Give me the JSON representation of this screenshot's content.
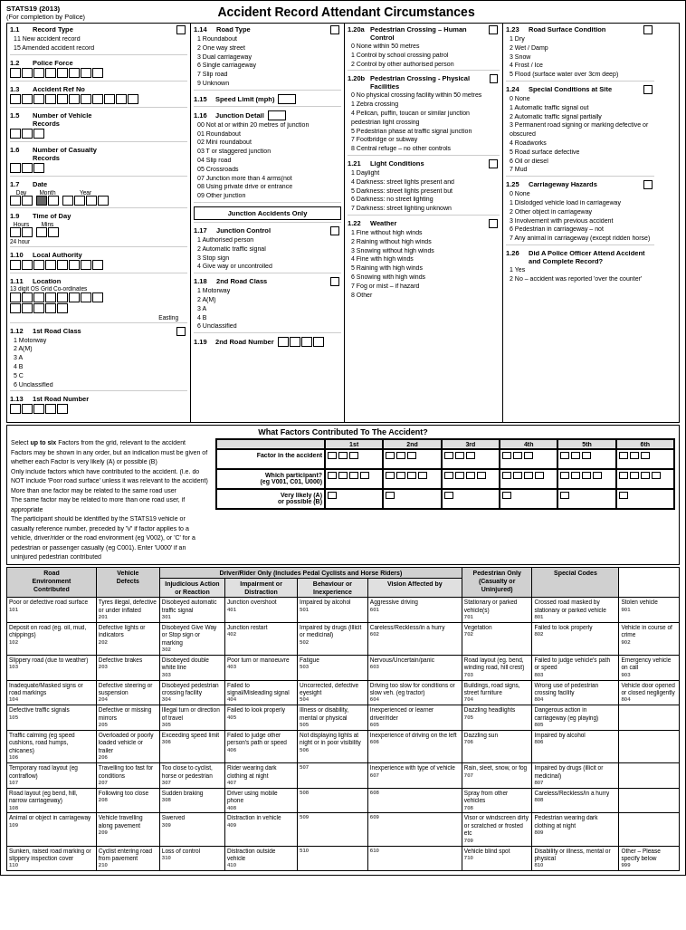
{
  "header": {
    "stats_title": "STATS19 (2013)",
    "completion": "(For completion by Police)",
    "main_title": "Accident Record  Attendant Circumstances"
  },
  "col1": {
    "fields": [
      {
        "id": "1.1",
        "label": "Record Type",
        "options": [
          "11  New accident record",
          "15  Amended accident record"
        ],
        "has_checkbox": true
      },
      {
        "id": "1.2",
        "label": "Police Force"
      },
      {
        "id": "1.3",
        "label": "Accident Ref No"
      },
      {
        "id": "1.5",
        "label": "Number of Vehicle Records"
      },
      {
        "id": "1.6",
        "label": "Number of Casualty Records"
      },
      {
        "id": "1.7",
        "label": "Date",
        "has_date": true,
        "date_labels": [
          "Day",
          "Month",
          "Year"
        ]
      },
      {
        "id": "1.9",
        "label": "Time of Day",
        "sub": "24 hour",
        "has_time": true,
        "time_labels": [
          "Hours",
          "Mins"
        ]
      },
      {
        "id": "1.10",
        "label": "Local Authority"
      },
      {
        "id": "1.11",
        "label": "Location",
        "sub": "13 digit OS Grid Co-ordinates",
        "has_easting": true
      },
      {
        "id": "1.12",
        "label": "1st Road Class",
        "options": [
          "1  Motorway",
          "2  A(M)",
          "3  A",
          "4  B",
          "5  C",
          "6  Unclassified"
        ],
        "has_checkbox": true
      },
      {
        "id": "1.13",
        "label": "1st Road Number"
      }
    ]
  },
  "col2": {
    "fields": [
      {
        "id": "1.14",
        "label": "Road Type",
        "options": [
          "1  Roundabout",
          "2  One way street",
          "3  Dual carriageway",
          "6  Single carriageway",
          "7  Slip road",
          "9  Unknown"
        ],
        "has_checkbox": true
      },
      {
        "id": "1.15",
        "label": "Speed Limit (mph)",
        "has_input": true
      },
      {
        "id": "1.16",
        "label": "Junction Detail",
        "options": [
          "00  Not at or within 20 metres of junction",
          "01  Roundabout",
          "02  Mini roundabout",
          "03  T or staggered junction",
          "04  Slip road",
          "05  Crossroads",
          "07  Junction more than 4 arms(not",
          "08  Using private drive or entrance",
          "09  Other junction"
        ],
        "has_input": true
      },
      {
        "id": "",
        "label": "Junction Accidents Only"
      },
      {
        "id": "1.17",
        "label": "Junction Control",
        "options": [
          "1  Authorised person",
          "2  Automatic traffic signal",
          "3  Stop sign",
          "4  Give way or uncontrolled"
        ],
        "has_checkbox": true
      },
      {
        "id": "1.18",
        "label": "2nd Road Class",
        "options": [
          "1  Motorway",
          "2  A(M)",
          "3  A",
          "4  B",
          "6  Unclassified"
        ],
        "has_checkbox": true
      },
      {
        "id": "1.19",
        "label": "2nd Road Number"
      }
    ]
  },
  "col3": {
    "fields": [
      {
        "id": "1.20a",
        "label": "Pedestrian Crossing – Human Control",
        "options": [
          "0  None within 50 metres",
          "1  Control by school crossing patrol",
          "2  Control by other authorised person"
        ],
        "has_checkbox": true
      },
      {
        "id": "1.20b",
        "label": "Pedestrian Crossing - Physical Facilities",
        "options": [
          "0  No physical crossing facility within 50 metres",
          "1  Zebra crossing",
          "4  Pelican, puffin, toucan or similar junction pedestrian light crossing",
          "5  Pedestrian phase at traffic signal junction",
          "7  Footbridge or subway",
          "8  Central refuge – no other controls"
        ],
        "has_checkbox": true
      },
      {
        "id": "1.21",
        "label": "Light Conditions",
        "options": [
          "1  Daylight",
          "4  Darkness: street lights present and",
          "5  Darkness: street lights present but",
          "6  Darkness: no street lighting",
          "7  Darkness: street lighting unknown"
        ],
        "has_checkbox": true
      },
      {
        "id": "1.22",
        "label": "Weather",
        "options": [
          "1  Fine without high winds",
          "2  Raining without high winds",
          "3  Snowing without high winds",
          "4  Fine with high winds",
          "5  Raining with high winds",
          "6  Snowing with high winds",
          "7  Fog or mist – if hazard",
          "8  Other"
        ],
        "has_checkbox": true
      }
    ]
  },
  "col4": {
    "fields": [
      {
        "id": "1.23",
        "label": "Road Surface Condition",
        "options": [
          "1  Dry",
          "2  Wet / Damp",
          "3  Snow",
          "4  Frost / Ice",
          "5  Flood (surface water over 3cm deep)"
        ],
        "has_checkbox": true
      },
      {
        "id": "1.24",
        "label": "Special Conditions at Site",
        "options": [
          "0  None",
          "1  Automatic traffic signal out",
          "2  Automatic traffic signal partially",
          "3  Permanent road signing or marking defective or obscured",
          "4  Roadworks",
          "5  Road surface defective",
          "6  Oil or diesel",
          "7  Mud"
        ],
        "has_checkbox": true
      },
      {
        "id": "1.25",
        "label": "Carriageway Hazards",
        "options": [
          "0  None",
          "1  Dislodged vehicle load in carriageway",
          "2  Other object in carriageway",
          "3  Involvement with previous accident",
          "6  Pedestrian in carriageway – not",
          "7  Any animal in carriageway (except ridden horse)"
        ],
        "has_checkbox": true
      },
      {
        "id": "1.26",
        "label": "Did A Police Officer Attend Accident and Complete Record?",
        "options": [
          "1  Yes",
          "2  No – accident was reported 'over the counter'"
        ],
        "has_checkbox": true
      }
    ]
  },
  "factors_section": {
    "title": "What Factors Contributed To The Accident?",
    "instructions": [
      "Select up to six Factors from the grid, relevant to the accident",
      "Factors may be shown in any order, but an indication must be given of whether each Factor is very likely (A) or possible (B)",
      "Only include factors which have contributed to the accident. (I.e. do NOT include 'Poor road surface' unless it was relevant to the accident)",
      "More than one factor may be related to the same road user",
      "The same factor may be related to more than one road user, if appropriate",
      "The participant should be identified by the STATS19 vehicle or casualty reference number, preceded by 'V' if factor applies to a vehicle, driver/rider or the road environment (eg V002), or 'C' for a pedestrian or passenger casualty (eg C001). Enter 'U000' if an uninjured pedestrian contributed"
    ],
    "columns": [
      "1st",
      "2nd",
      "3rd",
      "4th",
      "5th",
      "6th"
    ],
    "rows": [
      {
        "label": "Factor in the accident",
        "sub": ""
      },
      {
        "label": "Which participant?",
        "sub": "(eg V001, C01, U000)"
      },
      {
        "label": "Very likely (A) or possible (B)",
        "sub": ""
      }
    ]
  },
  "bottom_table": {
    "col_headers": [
      "Road Environment Contributed",
      "Vehicle Defects",
      "Driver/Rider Only (Includes Pedal Cyclists and Horse Riders)",
      "Pedestrian Only (Casualty or Uninjured)",
      "Special Codes"
    ],
    "driver_sub_headers": [
      "Injudicious Action or Reaction",
      "Impairment or Distraction",
      "Behaviour or Inexperience",
      "Vision Affected by"
    ],
    "rows": [
      {
        "road": "Poor or defective road surface",
        "road_code": "101",
        "vehicle": "Tyres illegal, defective or under inflated",
        "vehicle_code": "201",
        "action": "Disobeyed automatic traffic signal",
        "action_code": "301",
        "action2": "Junction overshoot",
        "action2_code": "401",
        "impair": "Impaired by alcohol",
        "impair_code": "501",
        "behav": "Aggressive driving",
        "behav_code": "601",
        "vision": "Stationary or parked vehicle(s)",
        "vision_code": "701",
        "ped": "Crossed road masked by stationary or parked vehicle",
        "ped_code": "801",
        "special": "Stolen vehicle",
        "special_code": "901"
      },
      {
        "road": "Deposit on road (eg. oil, mud, chippings)",
        "road_code": "102",
        "vehicle": "Defective lights or indicators",
        "vehicle_code": "202",
        "action": "Disobeyed Give Way or Stop sign or marking",
        "action_code": "302",
        "action2": "Junction restart",
        "action2_code": "402",
        "impair": "Impaired by drugs (illicit or medicinal)",
        "impair_code": "502",
        "behav": "Careless/Reckless/in a hurry",
        "behav_code": "602",
        "vision": "Vegetation",
        "vision_code": "702",
        "ped": "Failed to look properly",
        "ped_code": "802",
        "special": "Vehicle in course of crime",
        "special_code": "902"
      },
      {
        "road": "Slippery road (due to weather)",
        "road_code": "103",
        "vehicle": "Defective brakes",
        "vehicle_code": "203",
        "action": "Disobeyed double white line",
        "action_code": "303",
        "action2": "Poor turn or manoeuvre",
        "action2_code": "403",
        "impair": "Fatigue",
        "impair_code": "503",
        "behav": "Nervous/Uncertain/panic",
        "behav_code": "603",
        "vision": "Road layout (eg. bend, winding road, hill crest)",
        "vision_code": "703",
        "ped": "Failed to judge vehicle's path or speed",
        "ped_code": "803",
        "special": "Emergency vehicle on call",
        "special_code": "903"
      },
      {
        "road": "Inadequate/Masked signs or road markings",
        "road_code": "104",
        "vehicle": "Defective steering or suspension",
        "vehicle_code": "204",
        "action": "Disobeyed pedestrian crossing facility",
        "action_code": "304",
        "action2": "Failed to signal/Misleading signal",
        "action2_code": "404",
        "impair": "Uncorrected, defective eyesight",
        "impair_code": "504",
        "behav": "Driving too slow for conditions or slow veh. (eg tractor)",
        "behav_code": "604",
        "vision": "Buildings, road signs, street furniture",
        "vision_code": "704",
        "ped": "Wrong use of pedestrian crossing facility",
        "ped_code": "804",
        "special": "Vehicle door opened or closed negligently",
        "special_code": "804"
      },
      {
        "road": "Defective traffic signals",
        "road_code": "105",
        "vehicle": "Defective or missing mirrors",
        "vehicle_code": "205",
        "action": "Illegal turn or direction of travel",
        "action_code": "305",
        "action2": "Failed to look properly",
        "action2_code": "405",
        "impair": "Illness or disability, mental or physical",
        "impair_code": "505",
        "behav": "Inexperienced or learner driver/rider",
        "behav_code": "605",
        "vision": "Dazzling headlights",
        "vision_code": "705",
        "ped": "Dangerous action in carriageway (eg playing)",
        "ped_code": "805",
        "special": ""
      },
      {
        "road": "Traffic calming (eg speed cushions, road humps, chicanes)",
        "road_code": "106",
        "vehicle": "Overloaded or poorly loaded vehicle or trailer",
        "vehicle_code": "206",
        "action": "Exceeding speed limit",
        "action_code": "306",
        "action2": "Failed to judge other person's path or speed",
        "action2_code": "406",
        "impair": "Not displaying lights at night or in poor visibility",
        "impair_code": "506",
        "behav": "Inexperience of driving on the left",
        "behav_code": "606",
        "vision": "Dazzling sun",
        "vision_code": "706",
        "ped": "Impaired by alcohol",
        "ped_code": "806",
        "special": ""
      },
      {
        "road": "Temporary road layout (eg contraflow)",
        "road_code": "107",
        "vehicle": "Travelling too fast for conditions",
        "vehicle_code": "207",
        "action": "Too close to cyclist, horse or pedestrian",
        "action_code": "307",
        "action2": "Rider wearing dark clothing at night",
        "action2_code": "407",
        "impair": "",
        "impair_code": "507",
        "behav": "Inexperience with type of vehicle",
        "behav_code": "607",
        "vision": "Rain, sleet, snow, or fog",
        "vision_code": "707",
        "ped": "Impaired by drugs (illicit or medicinal)",
        "ped_code": "807",
        "special": ""
      },
      {
        "road": "Road layout (eg bend, hill, narrow carriageway)",
        "road_code": "108",
        "vehicle": "Following too close",
        "vehicle_code": "208",
        "action": "Sudden braking",
        "action_code": "308",
        "action2": "Driver using mobile phone",
        "action2_code": "408",
        "impair": "",
        "impair_code": "508",
        "behav": "",
        "behav_code": "608",
        "vision": "Spray from other vehicles",
        "vision_code": "708",
        "ped": "Careless/Reckless/in a hurry",
        "ped_code": "808",
        "special": ""
      },
      {
        "road": "Animal or object in carriageway",
        "road_code": "109",
        "vehicle": "Vehicle travelling along pavement",
        "vehicle_code": "209",
        "action": "Swerved",
        "action_code": "309",
        "action2": "Distraction in vehicle",
        "action2_code": "409",
        "impair": "",
        "impair_code": "509",
        "behav": "",
        "behav_code": "609",
        "vision": "Visor or windscreen dirty or scratched or frosted etc",
        "vision_code": "709",
        "ped": "Pedestrian wearing dark clothing at night",
        "ped_code": "809",
        "special": ""
      },
      {
        "road": "Sunken, raised road marking or slippery inspection cover",
        "road_code": "110",
        "vehicle": "Cyclist entering road from pavement",
        "vehicle_code": "210",
        "action": "Loss of control",
        "action_code": "310",
        "action2": "Distraction outside vehicle",
        "action2_code": "410",
        "impair": "",
        "impair_code": "510",
        "behav": "",
        "behav_code": "610",
        "vision": "Vehicle blind spot",
        "vision_code": "710",
        "ped": "Disability or illness, mental or physical",
        "ped_code": "810",
        "special": "Other – Please specify below",
        "special_code": "999"
      }
    ]
  }
}
